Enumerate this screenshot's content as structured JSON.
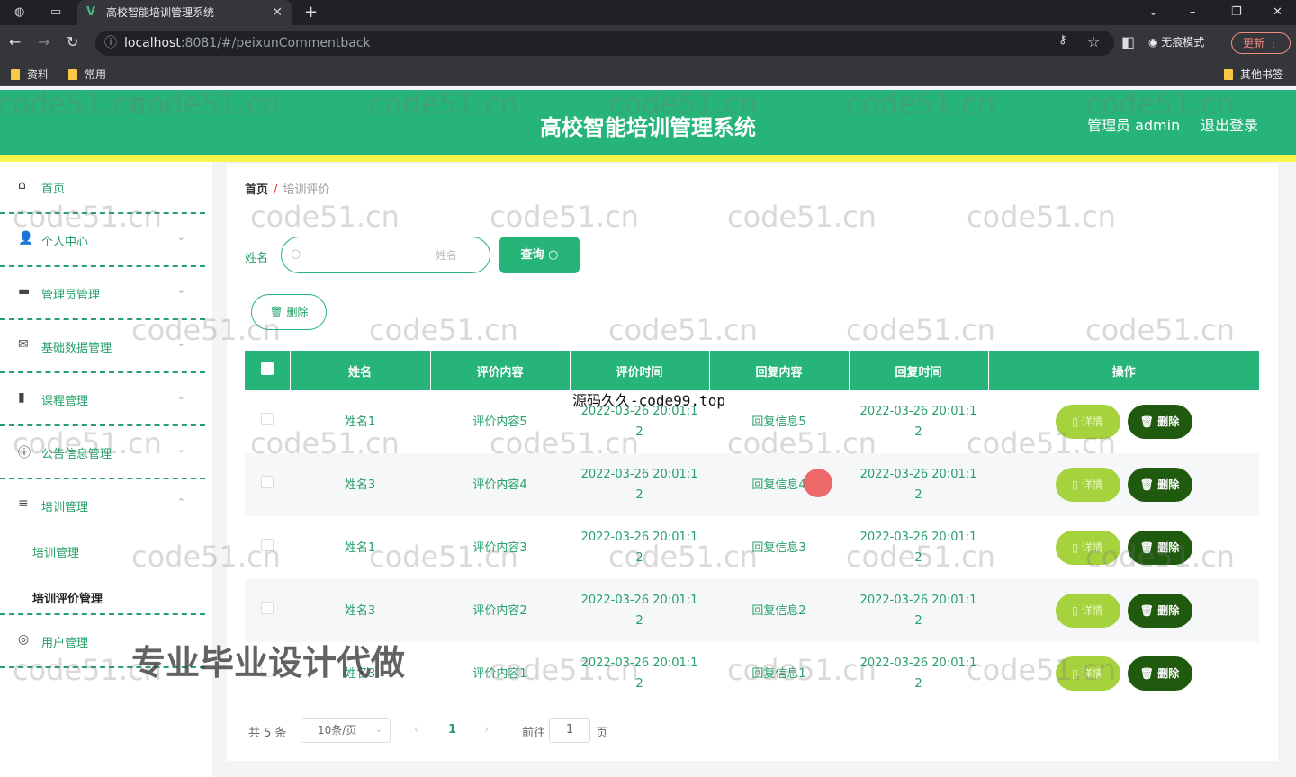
{
  "browser": {
    "tab_title": "高校智能培训管理系统",
    "url_host": "localhost",
    "url_rest": ":8081/#/peixunCommentback",
    "incognito_label": "无痕模式",
    "update_label": "更新",
    "bookmarks": [
      "资料",
      "常用"
    ],
    "other_bookmarks": "其他书签"
  },
  "header": {
    "title": "高校智能培训管理系统",
    "user": "管理员 admin",
    "logout": "退出登录"
  },
  "sidebar": {
    "items": [
      {
        "label": "首页",
        "icon": "home-icon"
      },
      {
        "label": "个人中心",
        "icon": "user-icon"
      },
      {
        "label": "管理员管理",
        "icon": "admin-icon"
      },
      {
        "label": "基础数据管理",
        "icon": "mail-icon"
      },
      {
        "label": "课程管理",
        "icon": "chart-icon"
      },
      {
        "label": "公告信息管理",
        "icon": "info-icon"
      },
      {
        "label": "培训管理",
        "icon": "list-icon"
      },
      {
        "label": "用户管理",
        "icon": "people-icon"
      }
    ],
    "submenu": [
      "培训管理",
      "培训评价管理"
    ]
  },
  "breadcrumb": {
    "home": "首页",
    "separator": "/",
    "current": "培训评价"
  },
  "search": {
    "label": "姓名",
    "placeholder": "姓名",
    "button": "查询"
  },
  "batch_delete": "删除",
  "table": {
    "headers": [
      "姓名",
      "评价内容",
      "评价时间",
      "回复内容",
      "回复时间",
      "操作"
    ],
    "rows": [
      {
        "name": "姓名1",
        "content": "评价内容5",
        "time_a": "2022-03-26 20:01:1",
        "time_b": "2",
        "reply": "回复信息5",
        "rtime_a": "2022-03-26 20:01:1",
        "rtime_b": "2"
      },
      {
        "name": "姓名3",
        "content": "评价内容4",
        "time_a": "2022-03-26 20:01:1",
        "time_b": "2",
        "reply": "回复信息4",
        "rtime_a": "2022-03-26 20:01:1",
        "rtime_b": "2"
      },
      {
        "name": "姓名1",
        "content": "评价内容3",
        "time_a": "2022-03-26 20:01:1",
        "time_b": "2",
        "reply": "回复信息3",
        "rtime_a": "2022-03-26 20:01:1",
        "rtime_b": "2"
      },
      {
        "name": "姓名3",
        "content": "评价内容2",
        "time_a": "2022-03-26 20:01:1",
        "time_b": "2",
        "reply": "回复信息2",
        "rtime_a": "2022-03-26 20:01:1",
        "rtime_b": "2"
      },
      {
        "name": "姓名3",
        "content": "评价内容1",
        "time_a": "2022-03-26 20:01:1",
        "time_b": "2",
        "reply": "回复信息1",
        "rtime_a": "2022-03-26 20:01:1",
        "rtime_b": "2"
      }
    ],
    "detail_label": "详情",
    "delete_label": "删除"
  },
  "pager": {
    "total": "共 5 条",
    "page_size": "10条/页",
    "current_page": "1",
    "goto": "前往",
    "goto_value": "1",
    "page_unit": "页"
  },
  "overlays": {
    "watermark": "code51.cn",
    "source_text": "源码久久-code99.top",
    "promo_text": "专业毕业设计代做"
  },
  "colors": {
    "primary": "#26b47a",
    "accent_bar": "#f5f54a",
    "detail_btn": "#a5d23d",
    "delete_btn": "#1f5a0e"
  }
}
